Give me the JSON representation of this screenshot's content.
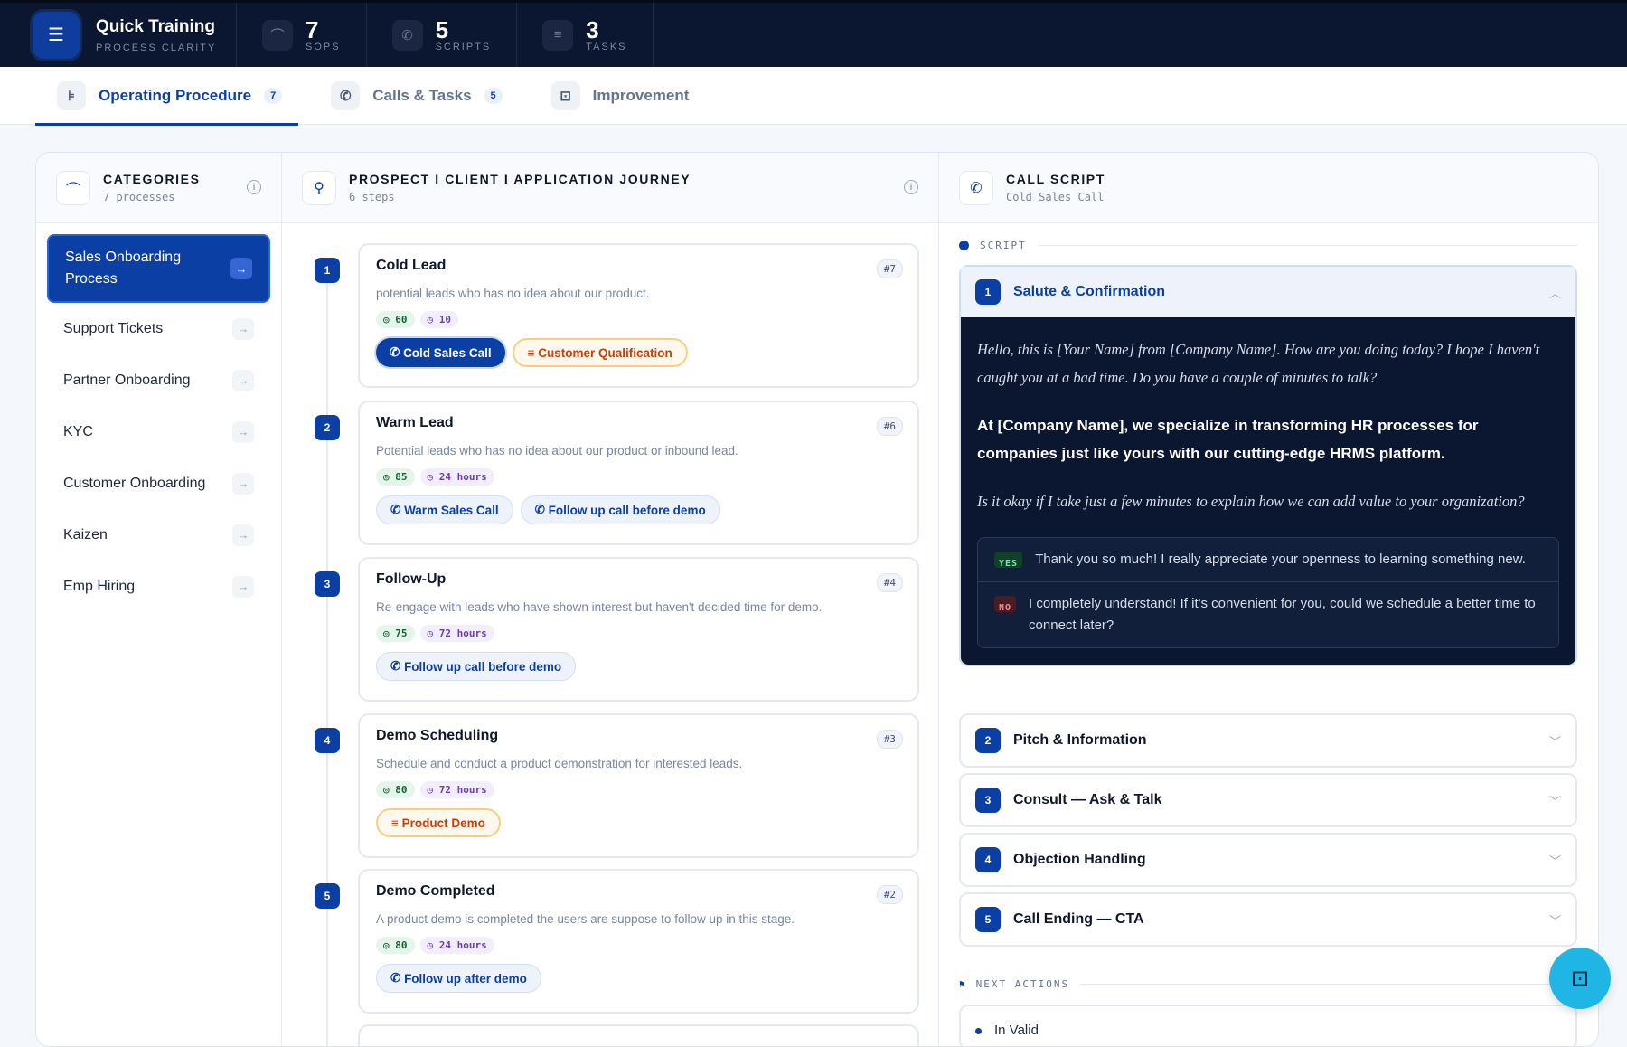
{
  "app": {
    "title": "Quick Training",
    "subtitle": "PROCESS CLARITY"
  },
  "stats": [
    {
      "num": "7",
      "label": "SOPS",
      "icon": "route-icon"
    },
    {
      "num": "5",
      "label": "SCRIPTS",
      "icon": "phone-icon"
    },
    {
      "num": "3",
      "label": "TASKS",
      "icon": "list-icon"
    }
  ],
  "tabs": [
    {
      "label": "Operating Procedure",
      "count": "7"
    },
    {
      "label": "Calls & Tasks",
      "count": "5"
    },
    {
      "label": "Improvement"
    }
  ],
  "categories": {
    "title": "CATEGORIES",
    "sub": "7 processes",
    "items": [
      "Sales Onboarding Process",
      "Support Tickets",
      "Partner Onboarding",
      "KYC",
      "Customer Onboarding",
      "Kaizen",
      "Emp Hiring"
    ]
  },
  "journey": {
    "title": "PROSPECT I CLIENT I APPLICATION JOURNEY",
    "sub": "6 steps",
    "steps": [
      {
        "num": "1",
        "title": "Cold Lead",
        "tag": "#7",
        "desc": "potential leads who has no idea about our product.",
        "score": "60",
        "time": "10",
        "btns": [
          "Cold Sales Call",
          "Customer Qualification"
        ]
      },
      {
        "num": "2",
        "title": "Warm Lead",
        "tag": "#6",
        "desc": "Potential leads who has no idea about our product or inbound lead.",
        "score": "85",
        "time": "24 hours",
        "btns": [
          "Warm Sales Call",
          "Follow up call before demo"
        ]
      },
      {
        "num": "3",
        "title": "Follow-Up",
        "tag": "#4",
        "desc": "Re-engage with leads who have shown interest but haven't decided time for demo.",
        "score": "75",
        "time": "72 hours",
        "btns": [
          "Follow up call before demo"
        ]
      },
      {
        "num": "4",
        "title": "Demo Scheduling",
        "tag": "#3",
        "desc": "Schedule and conduct a product demonstration for interested leads.",
        "score": "80",
        "time": "72 hours",
        "btns": [
          "Product Demo"
        ]
      },
      {
        "num": "5",
        "title": "Demo Completed",
        "tag": "#2",
        "desc": "A product demo is completed the users are suppose to follow up in this stage.",
        "score": "80",
        "time": "24 hours",
        "btns": [
          "Follow up after demo"
        ]
      }
    ]
  },
  "script": {
    "title": "CALL SCRIPT",
    "sub": "Cold Sales Call",
    "section": "SCRIPT",
    "sections": [
      {
        "num": "1",
        "title": "Salute & Confirmation"
      },
      {
        "num": "2",
        "title": "Pitch & Information"
      },
      {
        "num": "3",
        "title": "Consult — Ask & Talk"
      },
      {
        "num": "4",
        "title": "Objection Handling"
      },
      {
        "num": "5",
        "title": "Call Ending — CTA"
      }
    ],
    "line1": "Hello, this is [Your Name] from [Company Name]. How are you doing today? I hope I haven't caught you at a bad time. Do you have a couple of minutes to talk?",
    "line2": "At [Company Name], we specialize in transforming HR processes for companies just like yours with our cutting-edge HRMS platform.",
    "line3": "Is it okay if I take just a few minutes to explain how we can add value to your organization?",
    "yes_label": "YES",
    "yes_text": "Thank you so much! I really appreciate your openness to learning something new.",
    "no_label": "NO",
    "no_text": "I completely understand! If it's convenient for you, could we schedule a better time to connect later?",
    "next_label": "NEXT ACTIONS",
    "next_item": "In Valid"
  },
  "colors": {
    "primary": "#0b3fa3",
    "topbar": "#0b1630",
    "fab": "#1fb6e6"
  }
}
